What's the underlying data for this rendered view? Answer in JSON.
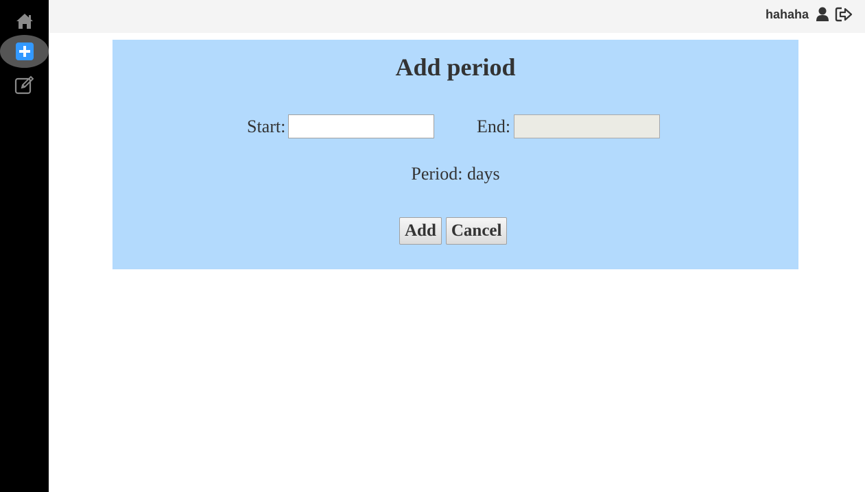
{
  "sidebar": {
    "items": [
      {
        "icon": "home-icon",
        "active": false
      },
      {
        "icon": "plus-square-icon",
        "active": true
      },
      {
        "icon": "edit-icon",
        "active": false
      }
    ],
    "active_color": "#3399ff"
  },
  "header": {
    "username": "hahaha",
    "user_icon": "user-icon",
    "logout_icon": "sign-out-icon"
  },
  "form": {
    "title": "Add period",
    "start_label": "Start:",
    "start_value": "",
    "end_label": "End:",
    "end_value": "",
    "period_text": "Period: days",
    "add_label": "Add",
    "cancel_label": "Cancel",
    "panel_color": "#b3dafd"
  }
}
